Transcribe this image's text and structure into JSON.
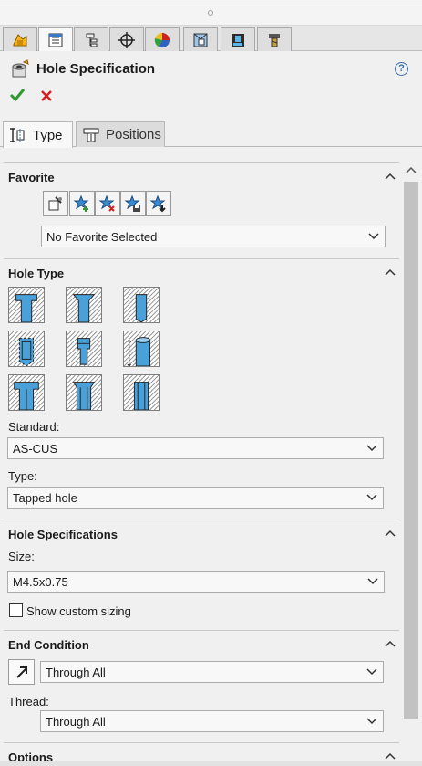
{
  "window": {
    "grip": ""
  },
  "manager_tabs": [
    {
      "icon": "feature-manager-icon",
      "active": false
    },
    {
      "icon": "property-manager-icon",
      "active": true
    },
    {
      "icon": "configuration-manager-icon",
      "active": false
    },
    {
      "icon": "dimxpert-manager-icon",
      "active": false
    },
    {
      "icon": "display-manager-icon",
      "active": false
    },
    {
      "icon": "cam-feature-manager-icon",
      "active": false
    },
    {
      "icon": "cam-operation-manager-icon",
      "active": false
    },
    {
      "icon": "cam-tool-manager-icon",
      "active": false
    }
  ],
  "header": {
    "title": "Hole Specification",
    "help": "?"
  },
  "pm_tabs": {
    "type": "Type",
    "positions": "Positions"
  },
  "favorite": {
    "heading": "Favorite",
    "buttons": [
      "apply-defaults-icon",
      "add-favorite-icon",
      "delete-favorite-icon",
      "save-favorite-icon",
      "load-favorite-icon"
    ],
    "selected": "No Favorite Selected"
  },
  "hole_type": {
    "heading": "Hole Type",
    "types": [
      "counterbore",
      "countersink",
      "hole",
      "straight-tap",
      "tapered-tap",
      "legacy-hole",
      "counterbore-slot",
      "countersink-slot",
      "slot"
    ],
    "standard_label": "Standard:",
    "standard_value": "AS-CUS",
    "type_label": "Type:",
    "type_value": "Tapped hole"
  },
  "hole_specs": {
    "heading": "Hole Specifications",
    "size_label": "Size:",
    "size_value": "M4.5x0.75",
    "custom_sizing": "Show custom sizing",
    "custom_sizing_checked": false
  },
  "end_condition": {
    "heading": "End Condition",
    "value": "Through All",
    "thread_label": "Thread:",
    "thread_value": "Through All"
  },
  "options": {
    "heading": "Options"
  },
  "colors": {
    "ok": "#2e9a2e",
    "cancel": "#d42020",
    "hole_fill": "#4aa0d8",
    "hatch": "#8a8a8a"
  }
}
